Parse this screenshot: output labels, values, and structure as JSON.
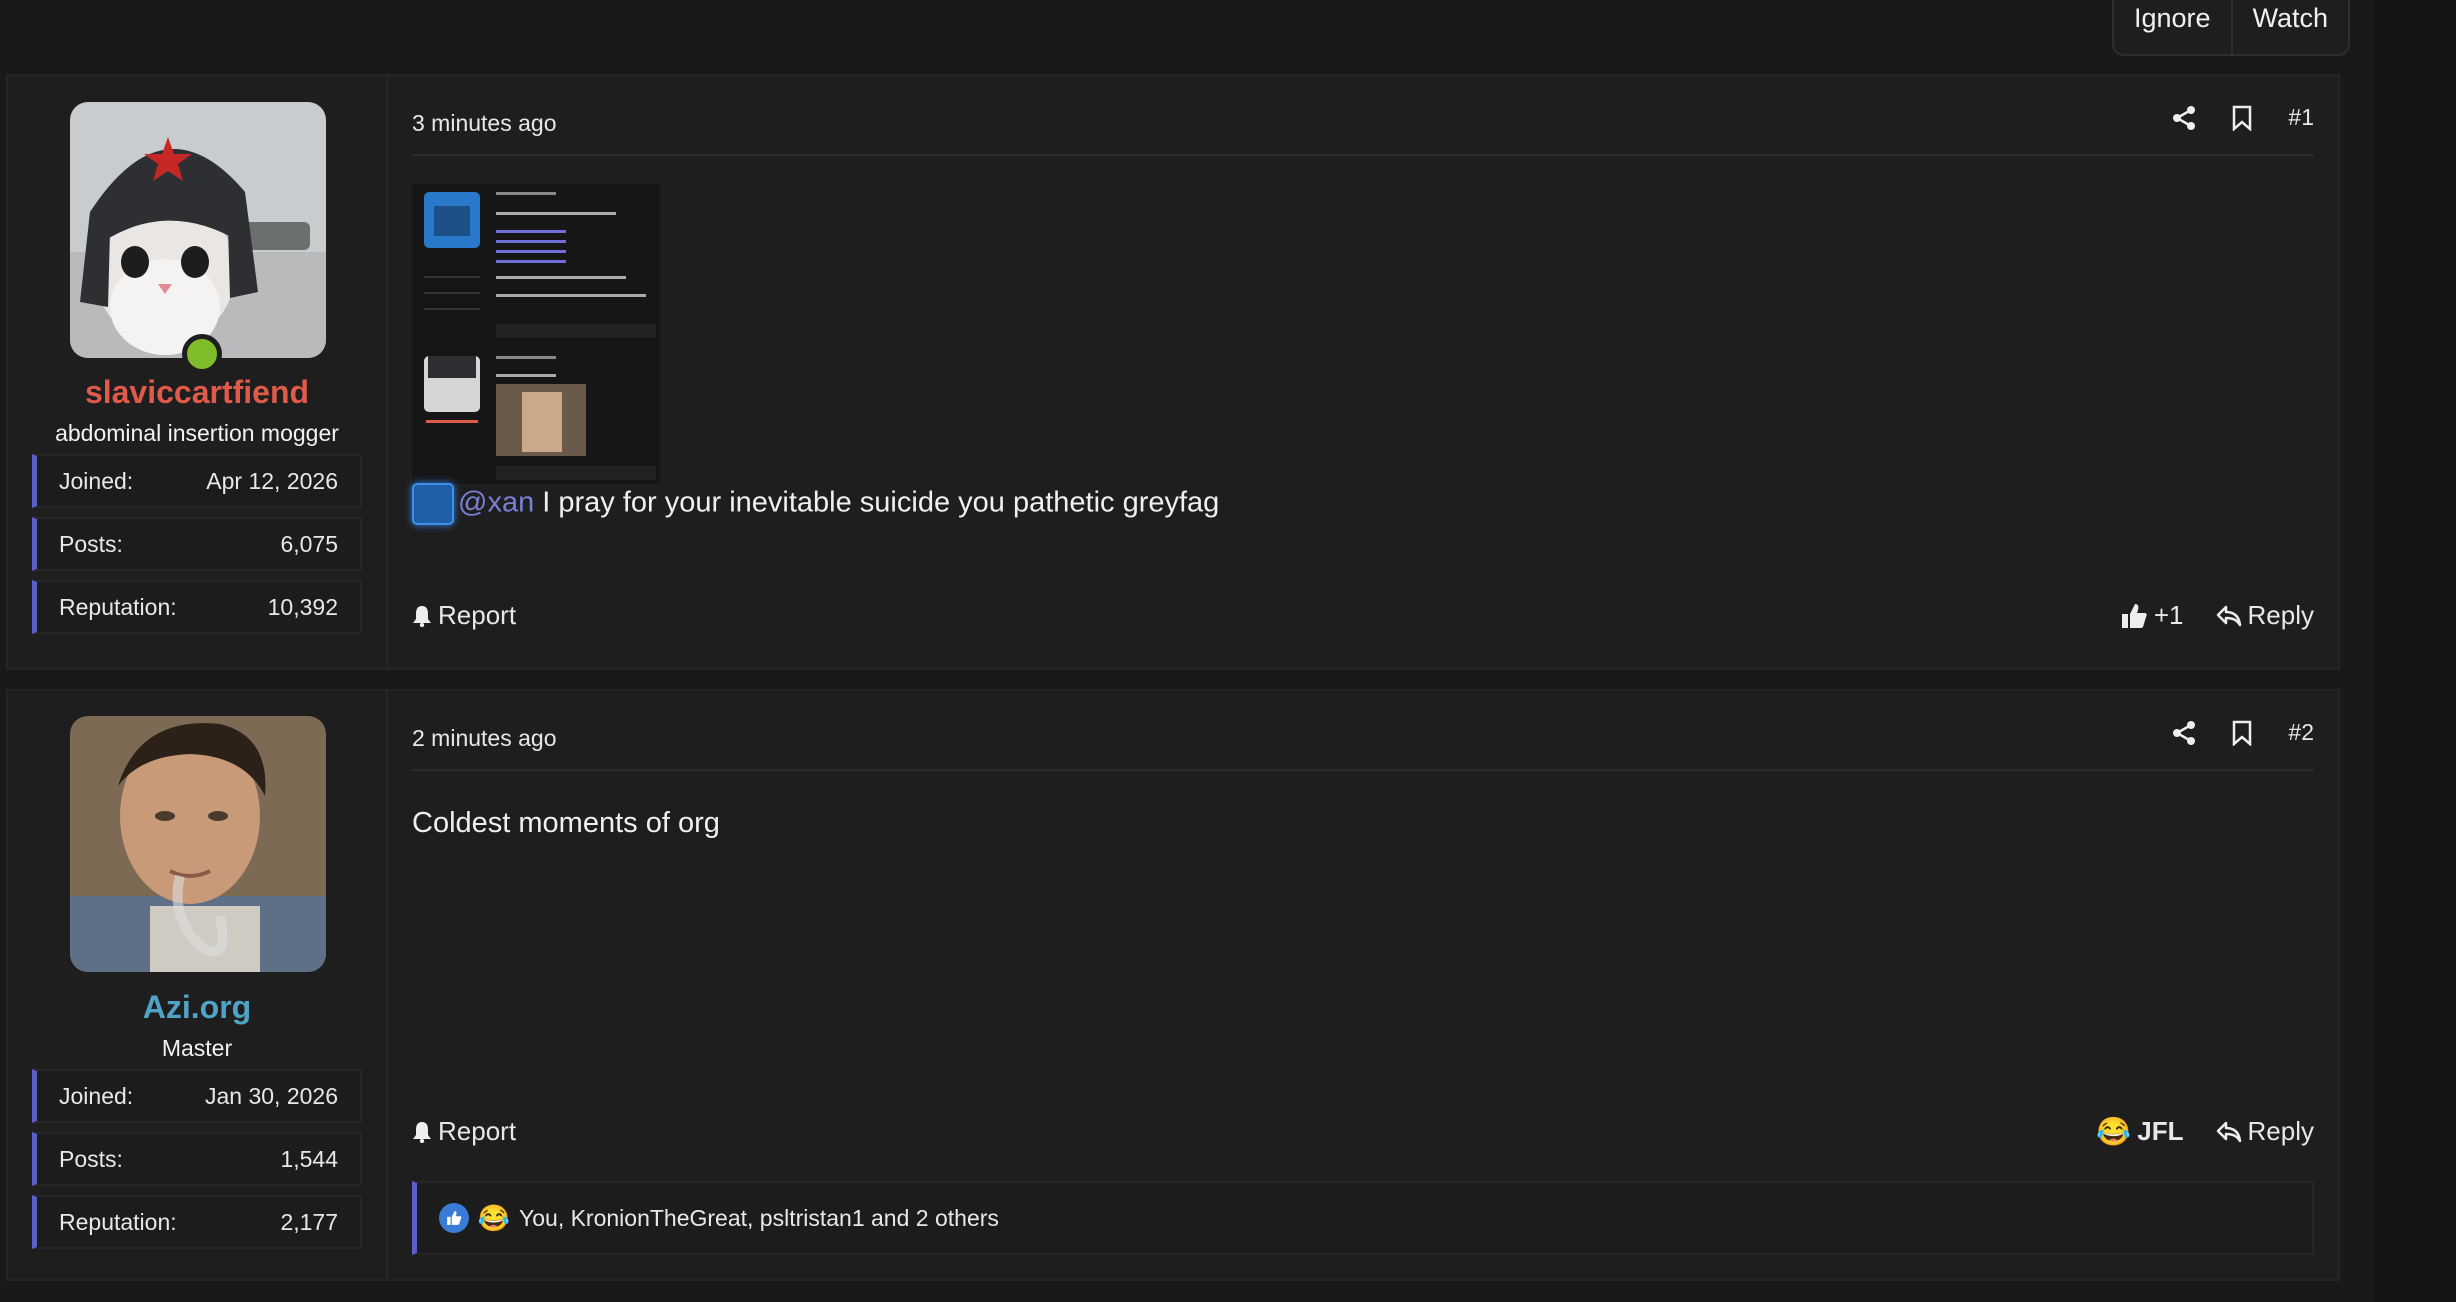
{
  "thread_actions": {
    "ignore": "Ignore",
    "watch": "Watch"
  },
  "posts": [
    {
      "user": {
        "name": "slaviccartfiend",
        "name_color": "#e05a4a",
        "title": "abdominal insertion mogger",
        "online": true,
        "stats": [
          {
            "label": "Joined:",
            "value": "Apr 12, 2026"
          },
          {
            "label": "Posts:",
            "value": "6,075"
          },
          {
            "label": "Reputation:",
            "value": "10,392"
          }
        ]
      },
      "time": "3 minutes ago",
      "number": "#1",
      "mention": "@xan",
      "body": " I pray for your inevitable suicide you pathetic greyfag",
      "report": "Report",
      "reaction_label": "+1",
      "reply": "Reply"
    },
    {
      "user": {
        "name": "Azi.org",
        "name_color": "#4fa3c7",
        "title": "Master",
        "online": false,
        "stats": [
          {
            "label": "Joined:",
            "value": "Jan 30, 2026"
          },
          {
            "label": "Posts:",
            "value": "1,544"
          },
          {
            "label": "Reputation:",
            "value": "2,177"
          }
        ]
      },
      "time": "2 minutes ago",
      "number": "#2",
      "body": "Coldest moments of org",
      "report": "Report",
      "reaction_label": "JFL",
      "reply": "Reply",
      "reactions_summary": "You, KronionTheGreat, psltristan1 and 2 others"
    }
  ]
}
